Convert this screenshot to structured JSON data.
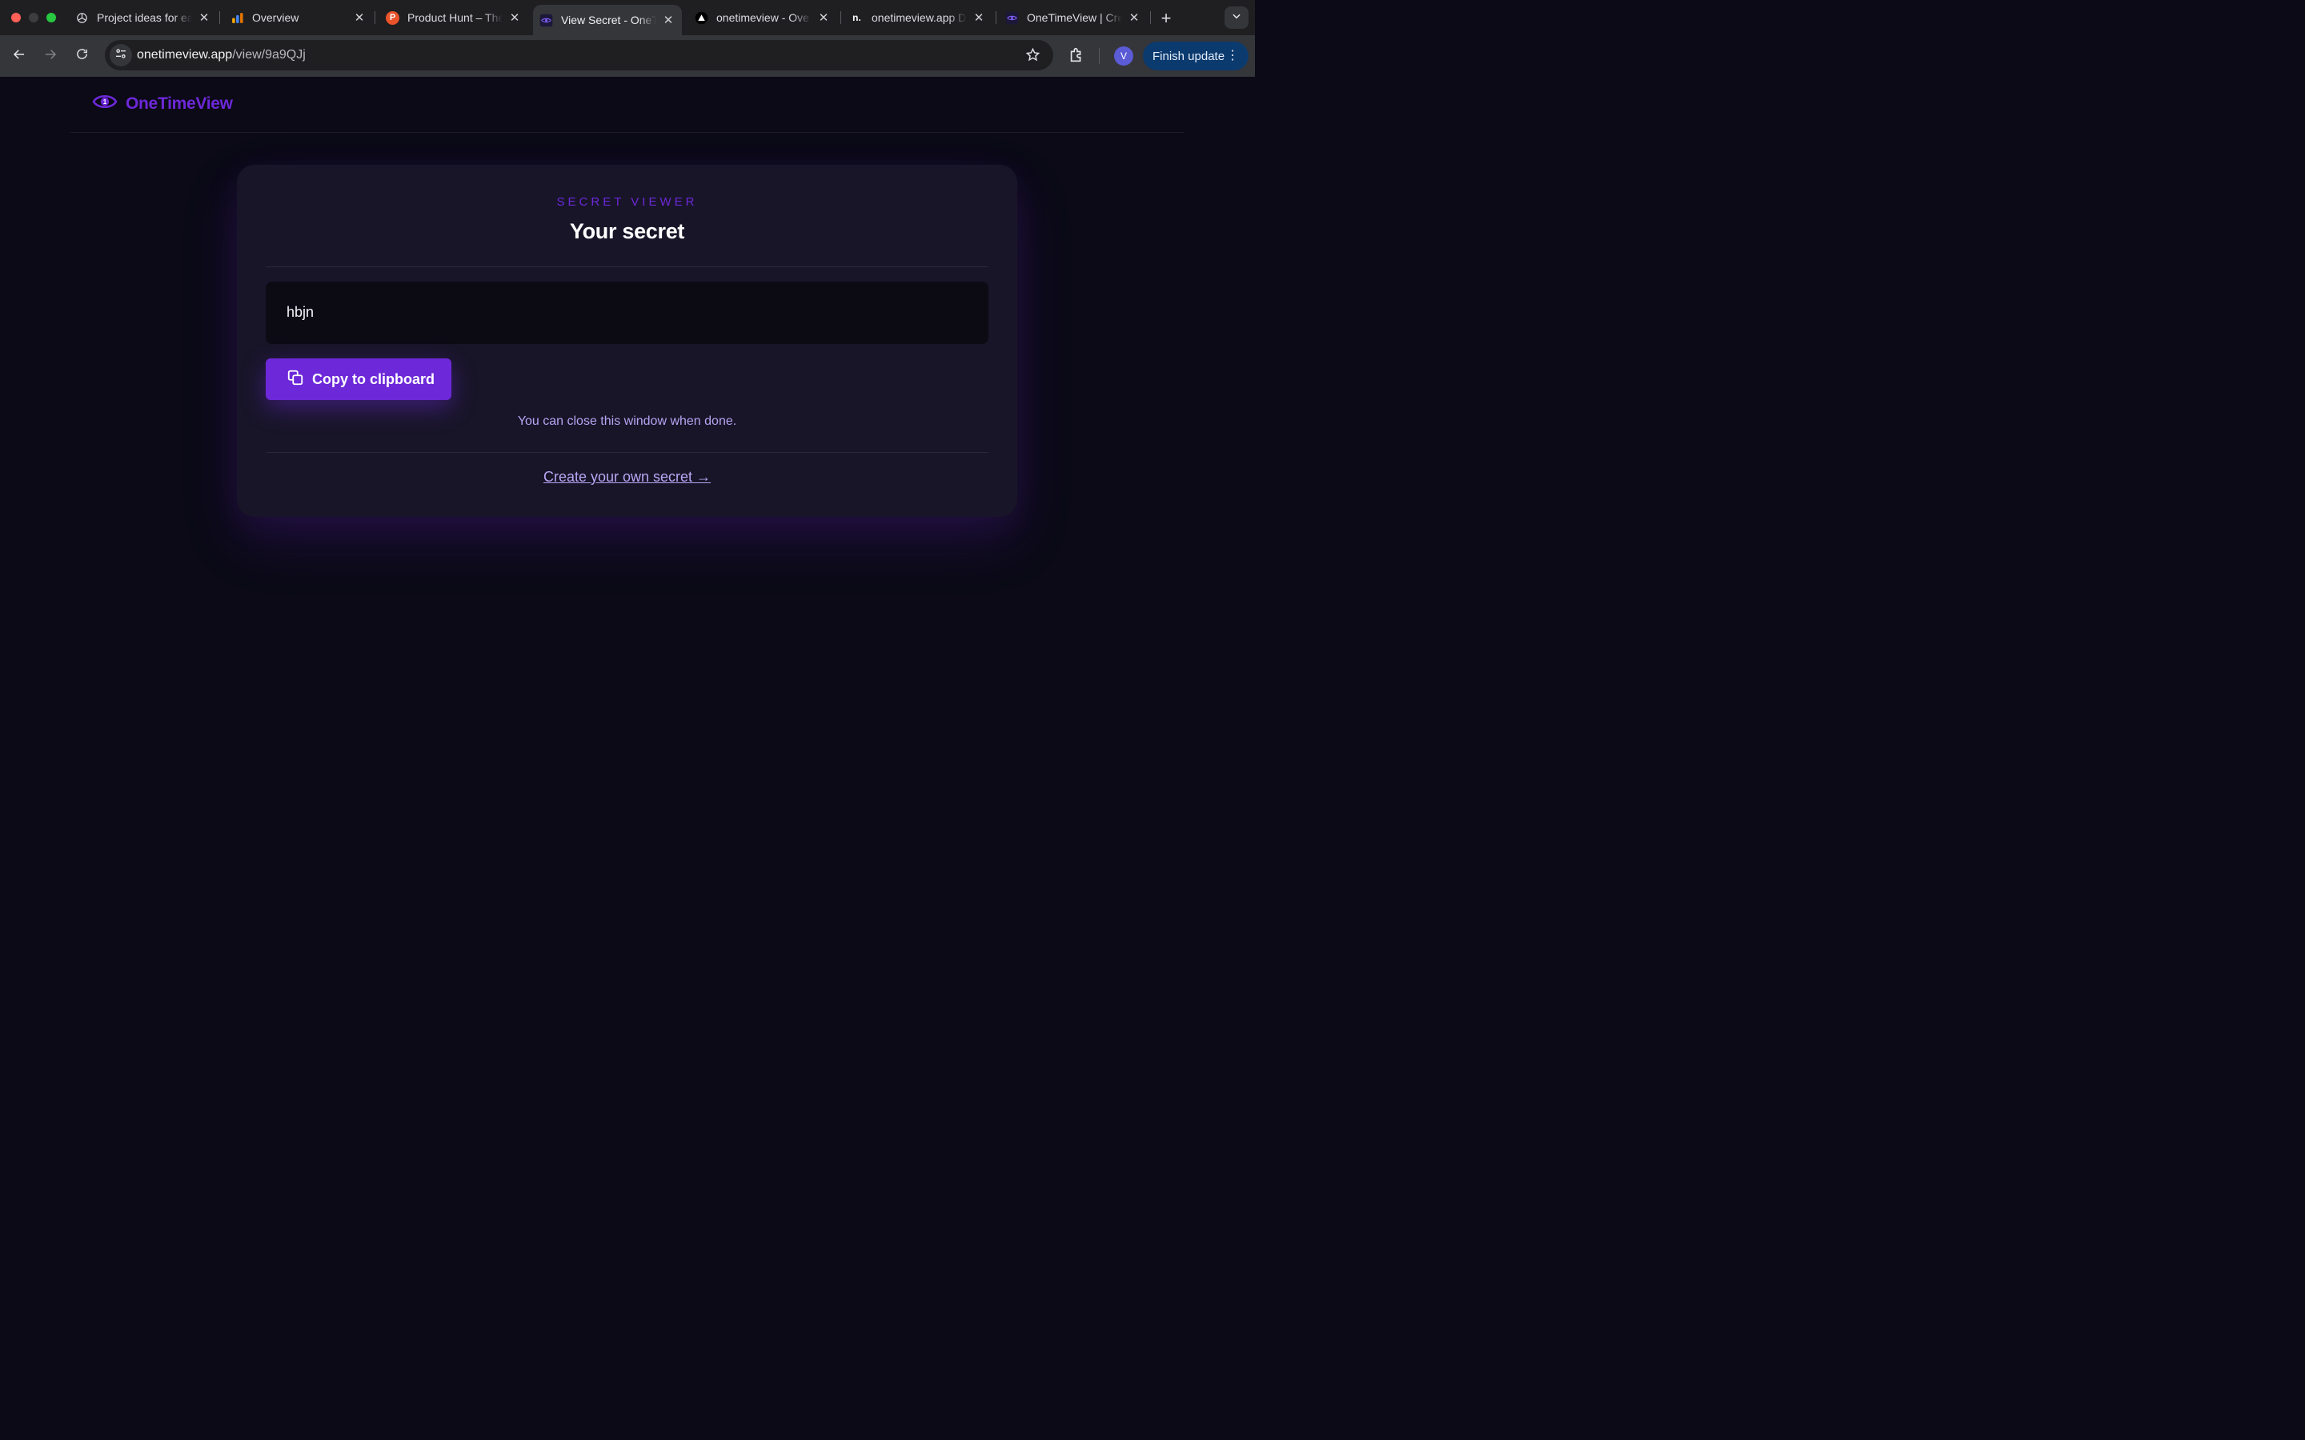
{
  "browser": {
    "tabs": [
      {
        "title": "Project ideas for ea",
        "icon": "openai-icon"
      },
      {
        "title": "Overview",
        "icon": "analytics-icon"
      },
      {
        "title": "Product Hunt – The",
        "icon": "product-hunt-icon"
      },
      {
        "title": "View Secret - OneT",
        "icon": "eye-icon",
        "active": true
      },
      {
        "title": "onetimeview - Ove",
        "icon": "vercel-icon"
      },
      {
        "title": "onetimeview.app D",
        "icon": "namecheap-icon"
      },
      {
        "title": "OneTimeView | Cre",
        "icon": "eye-icon"
      }
    ],
    "new_tab_label": "+",
    "url_host": "onetimeview.app",
    "url_path": "/view/9a9QJj",
    "avatar_letter": "V",
    "finish_update_label": "Finish update"
  },
  "site": {
    "logo_text": "OneTimeView",
    "brand_color": "#6d28d9"
  },
  "card": {
    "eyebrow": "SECRET VIEWER",
    "title": "Your secret",
    "secret_value": "hbjn",
    "copy_button_label": "Copy to clipboard",
    "note": "You can close this window when done.",
    "create_link": "Create your own secret →"
  }
}
